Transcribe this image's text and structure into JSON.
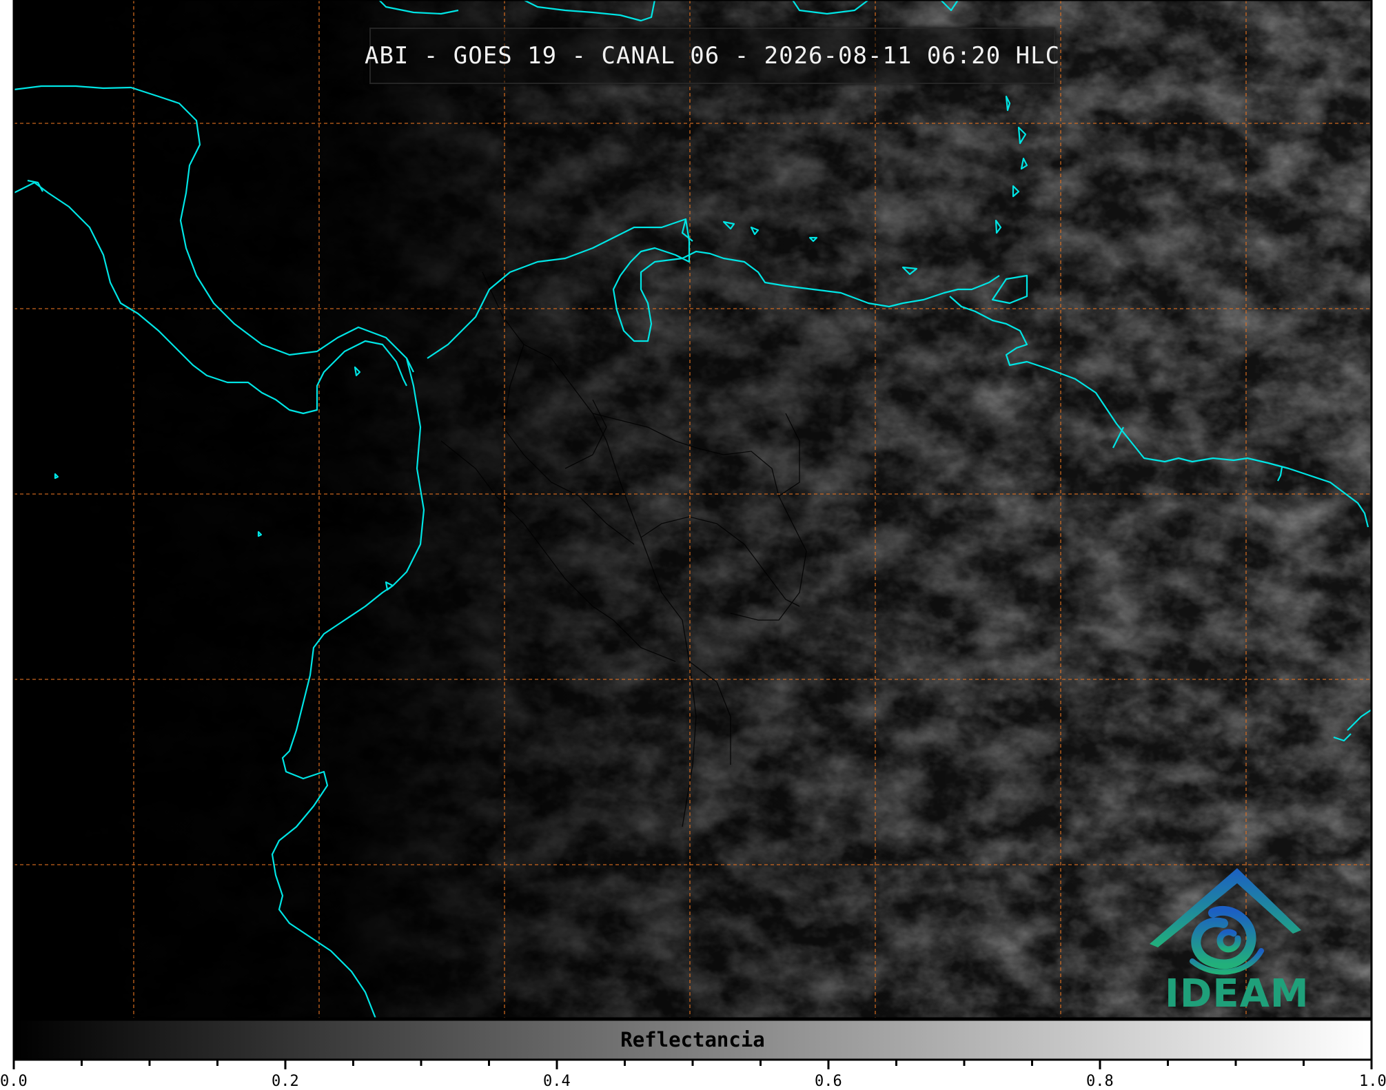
{
  "title": "ABI - GOES 19 - CANAL 06 - 2026-08-11 06:20 HLC",
  "colorbar": {
    "label": "Reflectancia",
    "min": 0.0,
    "max": 1.0,
    "ticks": [
      "0.0",
      "0.2",
      "0.4",
      "0.6",
      "0.8",
      "1.0"
    ],
    "colors": [
      "#000000",
      "#ffffff"
    ]
  },
  "map": {
    "coastline_color": "#00e5e5",
    "gridline_color": "#e07020",
    "border_color": "#000000",
    "grid": "dashed"
  },
  "logo": {
    "text": "IDEAM",
    "icon": "ideam-logo-icon",
    "colors": [
      "#1c6fc4",
      "#22b07a"
    ]
  }
}
